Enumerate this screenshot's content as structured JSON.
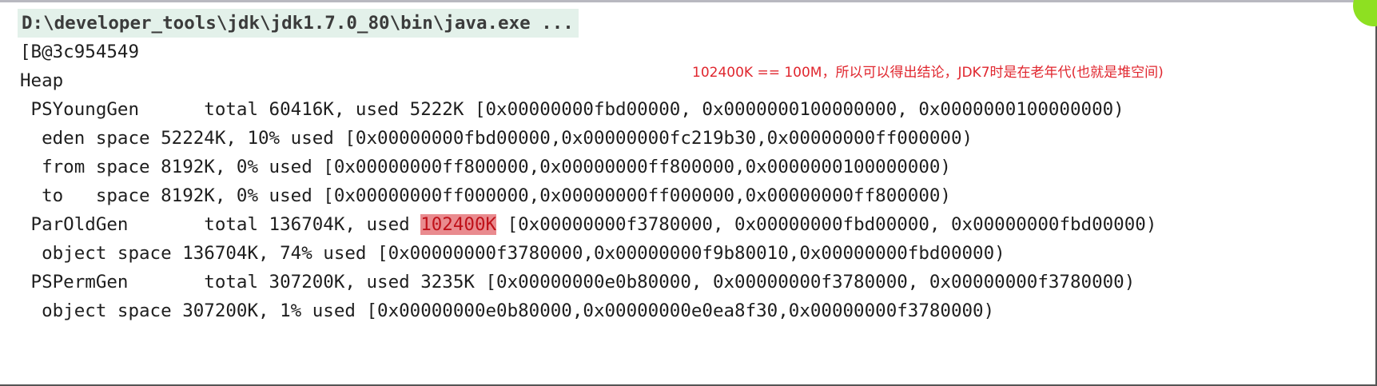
{
  "console": {
    "command_line": "D:\\developer_tools\\jdk\\jdk1.7.0_80\\bin\\java.exe ...",
    "lines": {
      "array_ref": "[B@3c954549",
      "heap": "Heap",
      "psyounggen": " PSYoungGen      total 60416K, used 5222K [0x00000000fbd00000, 0x0000000100000000, 0x0000000100000000)",
      "eden": "  eden space 52224K, 10% used [0x00000000fbd00000,0x00000000fc219b30,0x00000000ff000000)",
      "from": "  from space 8192K, 0% used [0x00000000ff800000,0x00000000ff800000,0x0000000100000000)",
      "to": "  to   space 8192K, 0% used [0x00000000ff000000,0x00000000ff000000,0x00000000ff800000)",
      "paroldgen_prefix": " ParOldGen       total 136704K, used ",
      "paroldgen_used": "102400K",
      "paroldgen_suffix": " [0x00000000f3780000, 0x00000000fbd00000, 0x00000000fbd00000)",
      "old_object": "  object space 136704K, 74% used [0x00000000f3780000,0x00000000f9b80010,0x00000000fbd00000)",
      "pspermgen": " PSPermGen       total 307200K, used 3235K [0x00000000e0b80000, 0x00000000f3780000, 0x00000000f3780000)",
      "perm_object": "  object space 307200K, 1% used [0x00000000e0b80000,0x00000000e0ea8f30,0x00000000f3780000)"
    }
  },
  "annotation": "102400K == 100M，所以可以得出结论，JDK7时是在老年代(也就是堆空间)",
  "colors": {
    "annotation": "#e0262e",
    "highlight": "#e98b8f",
    "command_bg": "#e3f1ea",
    "text": "#1e1e1e"
  }
}
